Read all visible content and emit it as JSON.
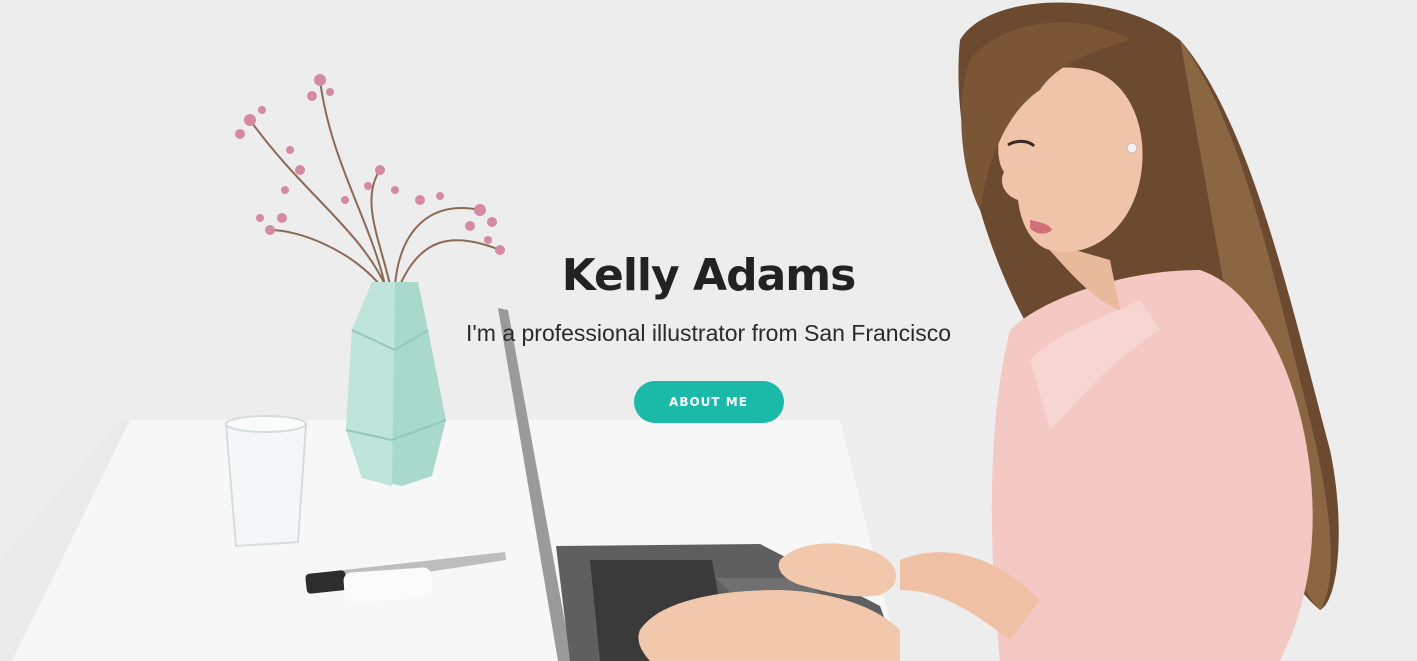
{
  "hero": {
    "title": "Kelly Adams",
    "subtitle": "I'm a professional illustrator from San Francisco",
    "button_label": "ABOUT ME"
  },
  "colors": {
    "accent": "#1ab9a8",
    "text_dark": "#222222",
    "background": "#ededed",
    "vase": "#a9d9cd",
    "blouse": "#f4c9c4"
  },
  "background_image": {
    "depicts": [
      "flower-vase",
      "water-glass",
      "marker-pen",
      "laptop",
      "woman-typing"
    ]
  }
}
